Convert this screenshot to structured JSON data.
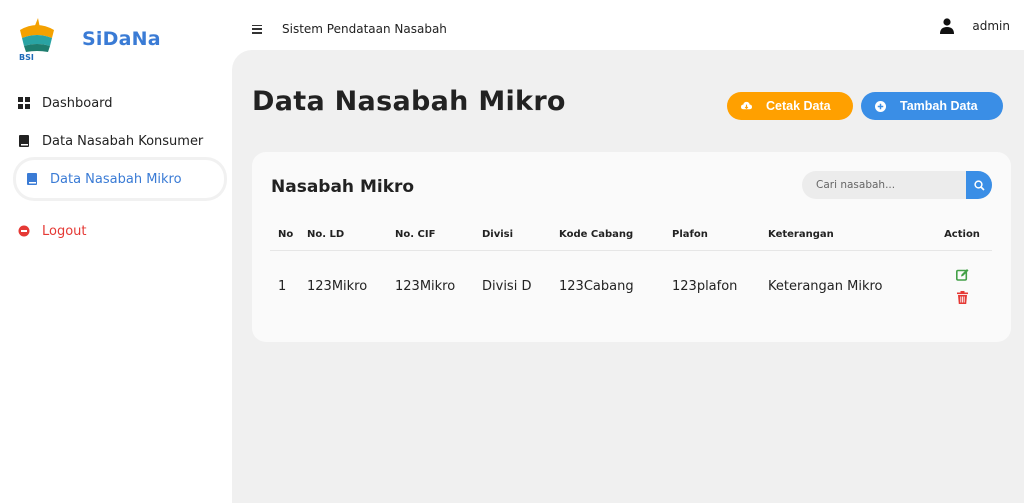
{
  "brand": {
    "name": "SiDaNa"
  },
  "topbar": {
    "title": "Sistem Pendataan Nasabah",
    "user": "admin"
  },
  "sidebar": {
    "items": [
      {
        "label": "Dashboard",
        "icon": "dashboard-icon"
      },
      {
        "label": "Data Nasabah Konsumer",
        "icon": "book-icon"
      },
      {
        "label": "Data Nasabah Mikro",
        "icon": "book-icon",
        "active": true
      },
      {
        "label": "Logout",
        "icon": "logout-icon"
      }
    ]
  },
  "page": {
    "title": "Data Nasabah Mikro",
    "cetak_label": "Cetak Data",
    "tambah_label": "Tambah Data"
  },
  "card": {
    "title": "Nasabah Mikro",
    "search_placeholder": "Cari nasabah..."
  },
  "table": {
    "headers": [
      "No",
      "No. LD",
      "No. CIF",
      "Divisi",
      "Kode Cabang",
      "Plafon",
      "Keterangan",
      "Action"
    ],
    "rows": [
      {
        "no": "1",
        "ld": "123Mikro",
        "cif": "123Mikro",
        "divisi": "Divisi D",
        "cabang": "123Cabang",
        "plafon": "123plafon",
        "keterangan": "Keterangan Mikro"
      }
    ]
  },
  "colors": {
    "accent": "#3a8ee6",
    "warning": "#ffa000",
    "danger": "#e53935",
    "success": "#43a047",
    "content_bg": "#f0f0f0"
  }
}
